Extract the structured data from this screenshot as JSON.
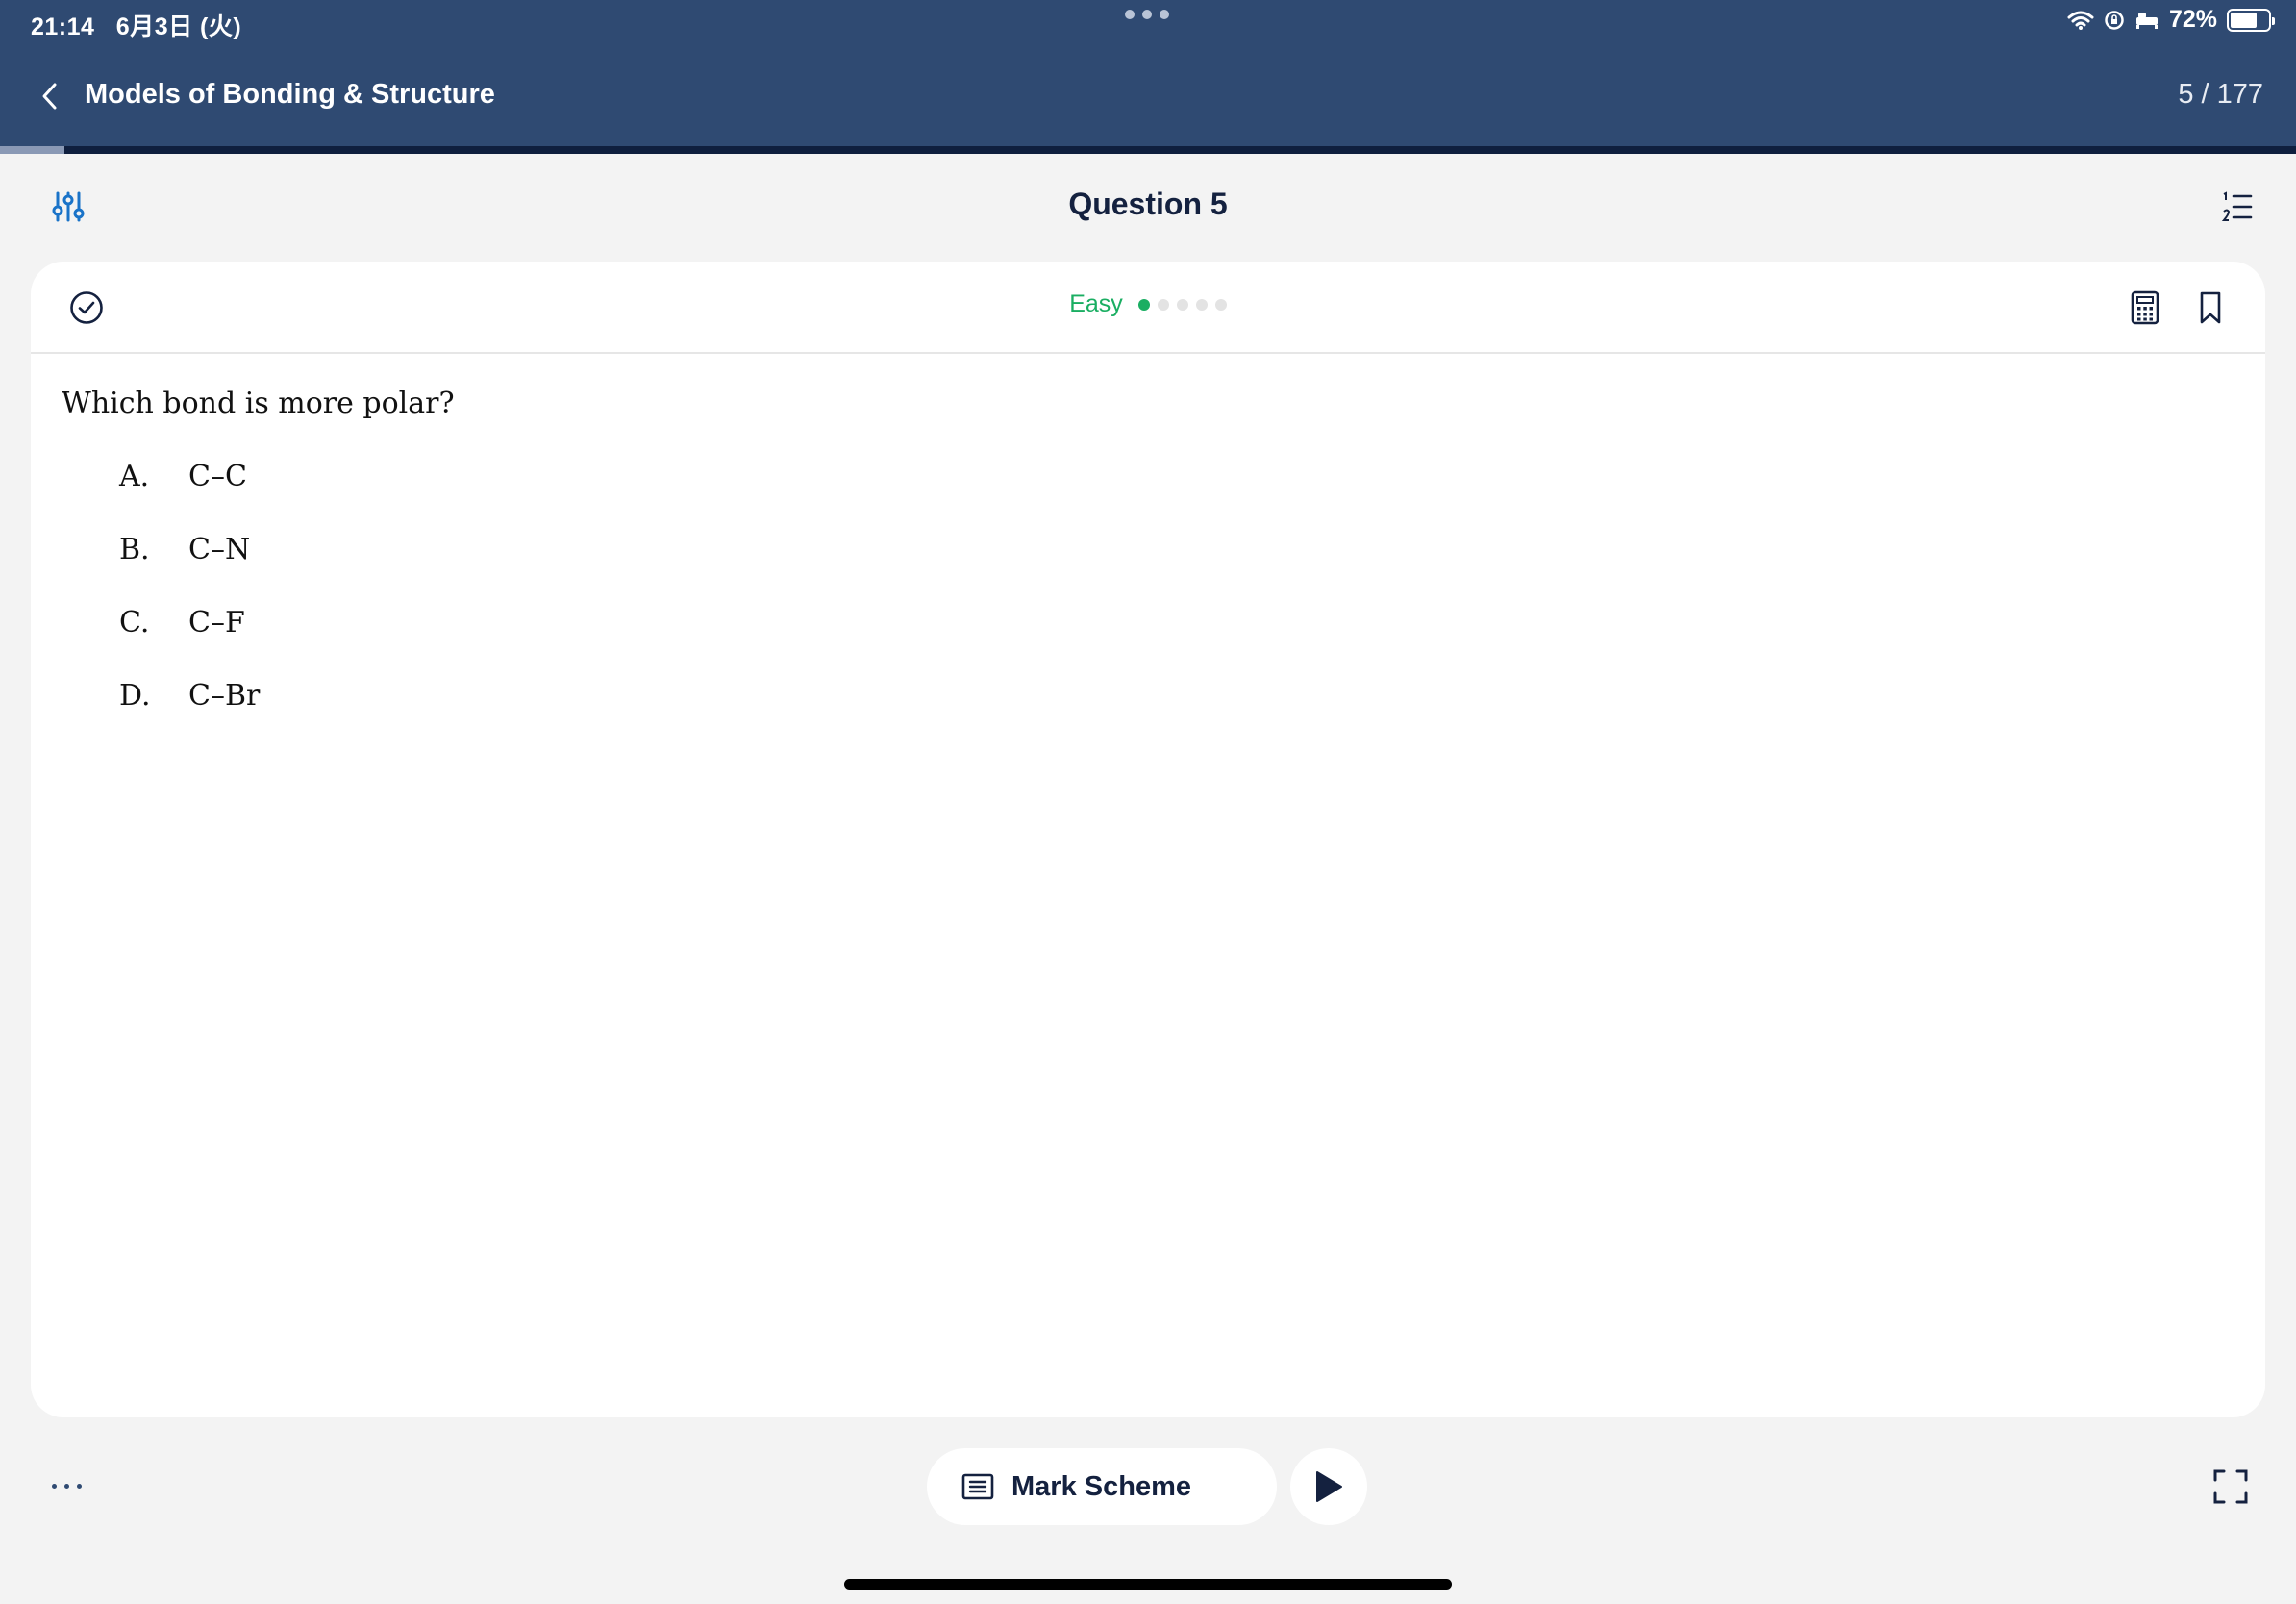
{
  "status_bar": {
    "time": "21:14",
    "date": "6月3日 (火)",
    "battery": "72%",
    "battery_level": 0.72
  },
  "header": {
    "title": "Models of Bonding & Structure",
    "position": "5 / 177",
    "progress": 0.028
  },
  "subheader": {
    "title": "Question 5"
  },
  "card": {
    "difficulty_label": "Easy",
    "difficulty_level": 1,
    "difficulty_max": 5,
    "question": "Which bond is more polar?",
    "options": [
      {
        "letter": "A.",
        "text": "C–C"
      },
      {
        "letter": "B.",
        "text": "C–N"
      },
      {
        "letter": "C.",
        "text": "C–F"
      },
      {
        "letter": "D.",
        "text": "C–Br"
      }
    ]
  },
  "footer": {
    "mark_scheme_label": "Mark Scheme"
  },
  "colors": {
    "header_bg": "#2f4a72",
    "accent_blue": "#1a73c8",
    "easy_green": "#1aae62",
    "dark_navy": "#14213f"
  }
}
